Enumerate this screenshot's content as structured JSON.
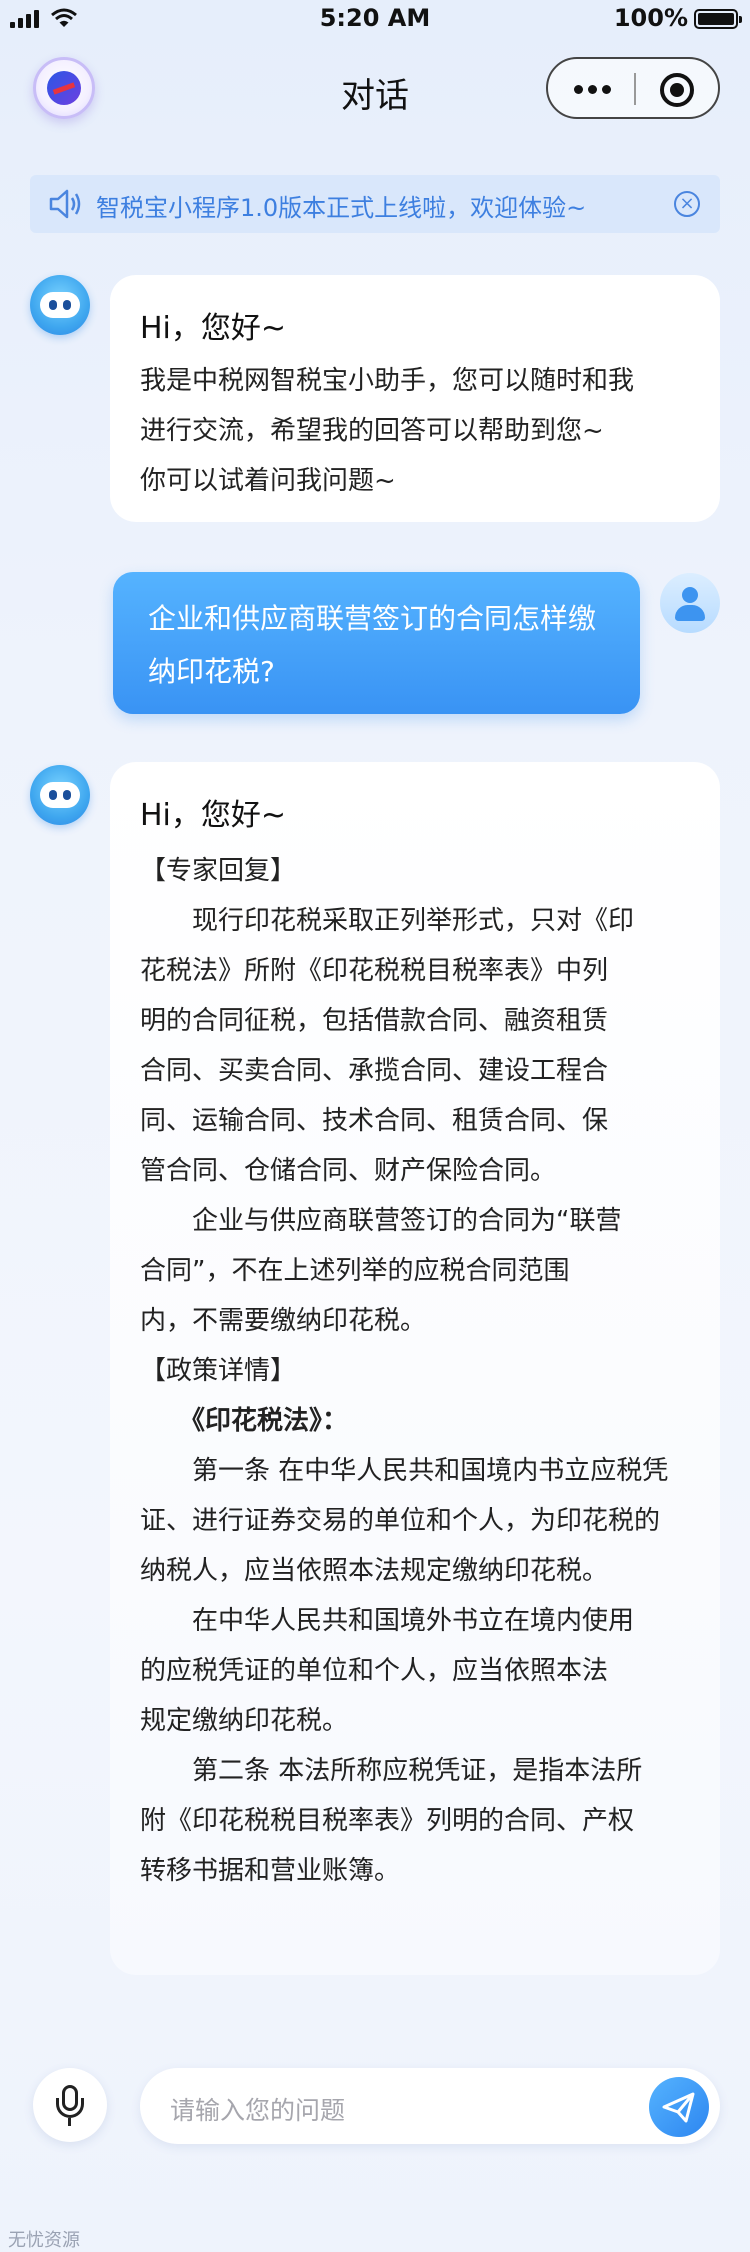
{
  "status_bar": {
    "time": "5:20 AM",
    "battery": "100%"
  },
  "nav": {
    "title": "对话",
    "more_icon": "ellipsis-icon",
    "close_icon": "target-icon"
  },
  "notice": {
    "text": "智税宝小程序1.0版本正式上线啦，欢迎体验~",
    "icon": "speaker-icon",
    "close_icon": "circle-x-icon"
  },
  "messages": {
    "bot1": {
      "greeting": "Hi，您好~",
      "lines": [
        "我是中税网智税宝小助手，您可以随时和我",
        "进行交流，希望我的回答可以帮助到您~",
        "你可以试着问我问题~"
      ]
    },
    "user": {
      "lines": [
        "企业和供应商联营签订的合同怎样缴",
        "纳印花税?"
      ]
    },
    "bot2": {
      "greeting": "Hi，您好~",
      "lines": [
        "【专家回复】",
        "　　现行印花税采取正列举形式，只对《印",
        "花税法》所附《印花税税目税率表》中列",
        "明的合同征税，包括借款合同、融资租赁",
        "合同、买卖合同、承揽合同、建设工程合",
        "同、运输合同、技术合同、租赁合同、保",
        "管合同、仓储合同、财产保险合同。",
        "　　企业与供应商联营签订的合同为“联营",
        "合同”，不在上述列举的应税合同范围",
        "内，不需要缴纳印花税。",
        "【政策详情】",
        "　　《印花税法》：",
        "　　第一条 在中华人民共和国境内书立应税凭",
        "证、进行证券交易的单位和个人，为印花税的",
        "纳税人，应当依照本法规定缴纳印花税。",
        "　　在中华人民共和国境外书立在境内使用",
        "的应税凭证的单位和个人，应当依照本法",
        "规定缴纳印花税。",
        "　　第二条 本法所称应税凭证，是指本法所",
        "附《印花税税目税率表》列明的合同、产权",
        "转移书据和营业账簿。"
      ]
    }
  },
  "input_bar": {
    "placeholder": "请输入您的问题",
    "mic_icon": "microphone-icon",
    "send_icon": "paper-plane-icon"
  },
  "watermark": "无忧资源"
}
